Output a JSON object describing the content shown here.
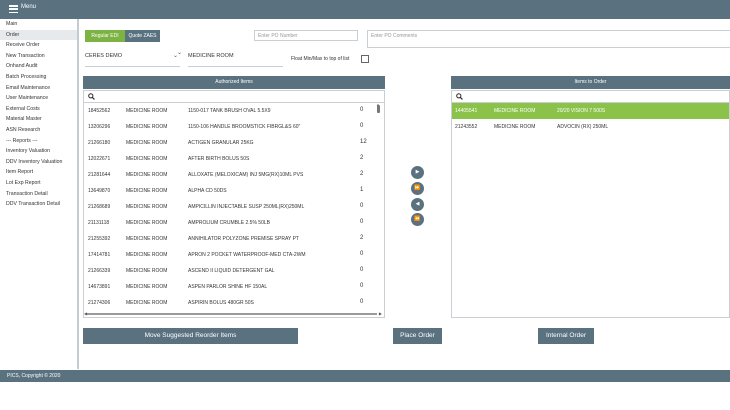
{
  "header": {
    "menu_label": "Menu"
  },
  "sidebar": {
    "items": [
      {
        "label": "Main"
      },
      {
        "label": "Order",
        "active": true
      },
      {
        "label": "Receive Order"
      },
      {
        "label": "New Transaction"
      },
      {
        "label": "Onhand Audit"
      },
      {
        "label": "Batch Processing"
      },
      {
        "label": "Email Maintenance"
      },
      {
        "label": "User Maintenance"
      },
      {
        "label": "External Costs"
      },
      {
        "label": "Material Master"
      },
      {
        "label": "ASN Research"
      },
      {
        "label": "--- Reports ---"
      },
      {
        "label": "Inventory Valuation"
      },
      {
        "label": "DDV Inventory Valuation"
      },
      {
        "label": "Item Report"
      },
      {
        "label": "Lot Exp Report"
      },
      {
        "label": "Transaction Detail"
      },
      {
        "label": "DDV Transaction Detail"
      }
    ]
  },
  "order": {
    "tabs": {
      "regular": "Regular EDI",
      "quote": "Quote ZAES"
    },
    "po_number_placeholder": "Enter PO Number",
    "po_comments_placeholder": "Enter PO Comments",
    "account": "CERES DEMO",
    "location": "MEDICINE ROOM",
    "float_label": "Float Min/Max to top of list",
    "float_checked": false
  },
  "authorized": {
    "title": "Authorized Items",
    "rows": [
      {
        "id": "18452562",
        "loc": "MEDICINE ROOM",
        "desc": "1150-017 TANK BRUSH OVAL 5.5X9",
        "qty": "0"
      },
      {
        "id": "13206296",
        "loc": "MEDICINE ROOM",
        "desc": "1150-106 HANDLE BROOMSTICK FIBRGL&S 60\"",
        "qty": "0"
      },
      {
        "id": "21266180",
        "loc": "MEDICINE ROOM",
        "desc": "ACTIGEN GRANULAR 25KG",
        "qty": "12"
      },
      {
        "id": "12022671",
        "loc": "MEDICINE ROOM",
        "desc": "AFTER BIRTH BOLUS 50S",
        "qty": "2"
      },
      {
        "id": "21281644",
        "loc": "MEDICINE ROOM",
        "desc": "ALLOXATE (MELOXICAM) INJ 5MG(RX)10ML PVS",
        "qty": "2"
      },
      {
        "id": "13649870",
        "loc": "MEDICINE ROOM",
        "desc": "ALPHA CD 50DS",
        "qty": "1"
      },
      {
        "id": "21268689",
        "loc": "MEDICINE ROOM",
        "desc": "AMPICILLIN INJECTABLE SUSP 250ML(RX)250ML",
        "qty": "0"
      },
      {
        "id": "21131118",
        "loc": "MEDICINE ROOM",
        "desc": "AMPROLIUM CRUMBLE 2.5% 50LB",
        "qty": "0"
      },
      {
        "id": "21255392",
        "loc": "MEDICINE ROOM",
        "desc": "ANNIHILATOR POLYZONE PREMISE SPRAY PT",
        "qty": "2"
      },
      {
        "id": "17414781",
        "loc": "MEDICINE ROOM",
        "desc": "APRON 2 POCKET WATERPROOF-MED CTA-2WM",
        "qty": "0"
      },
      {
        "id": "21266339",
        "loc": "MEDICINE ROOM",
        "desc": "ASCEND II LIQUID DETERGENT GAL",
        "qty": "0"
      },
      {
        "id": "14673891",
        "loc": "MEDICINE ROOM",
        "desc": "ASPEN PARLOR SHINE HF 150AL",
        "qty": "0"
      },
      {
        "id": "21274306",
        "loc": "MEDICINE ROOM",
        "desc": "ASPIRIN BOLUS 480GR 50S",
        "qty": "0"
      }
    ]
  },
  "items_to_order": {
    "title": "Items to Order",
    "rows": [
      {
        "id": "14405541",
        "loc": "MEDICINE ROOM",
        "desc": "20/20 VISION 7 500S",
        "selected": true
      },
      {
        "id": "21243552",
        "loc": "MEDICINE ROOM",
        "desc": "ADVOCIN (RX) 250ML",
        "selected": false
      }
    ]
  },
  "move_buttons": [
    "move-right",
    "move-all-right",
    "move-left",
    "move-all-left"
  ],
  "actions": {
    "move_suggested": "Move Suggested Reorder Items",
    "place_order": "Place Order",
    "internal_order": "Internal Order"
  },
  "footer": {
    "copyright": "PICS, Copyright © 2020"
  },
  "colors": {
    "header": "#5a7280",
    "accent": "#7cb342",
    "selected_row": "#8bc34a"
  }
}
